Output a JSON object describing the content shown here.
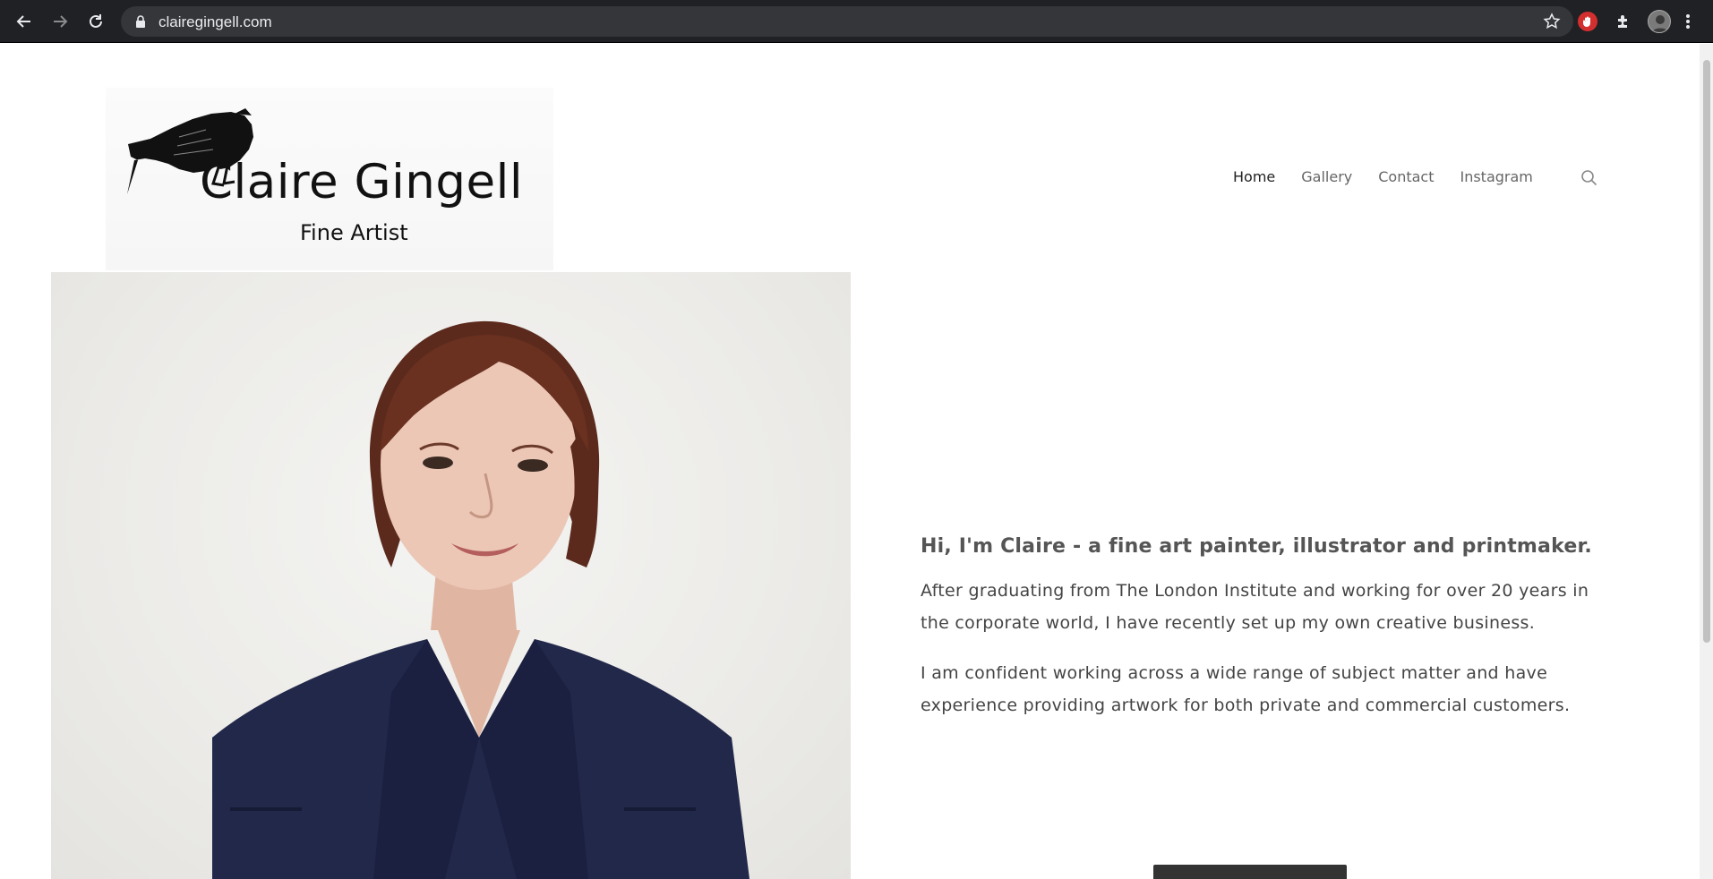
{
  "browser": {
    "url": "clairegingell.com"
  },
  "site": {
    "brand": "Claire Gingell",
    "tagline": "Fine Artist"
  },
  "nav": {
    "items": [
      {
        "label": "Home",
        "active": true
      },
      {
        "label": "Gallery",
        "active": false
      },
      {
        "label": "Contact",
        "active": false
      },
      {
        "label": "Instagram",
        "active": false
      }
    ]
  },
  "intro": {
    "heading": "Hi, I'm Claire - a fine art painter, illustrator and printmaker.",
    "paragraphs": [
      "After graduating from The London Institute and working for over 20 years in the corporate world, I have recently set up my own creative business.",
      "I am confident working across a wide range of subject matter and have experience providing artwork for both private and commercial customers."
    ]
  },
  "colors": {
    "chrome_bg": "#202124",
    "omnibox_bg": "#35363a",
    "heading_text": "#555555",
    "body_text": "#444444",
    "button_bg": "#333333"
  },
  "icons": [
    "back-icon",
    "forward-icon",
    "reload-icon",
    "lock-icon",
    "bookmark-star-icon",
    "adblock-icon",
    "extensions-icon",
    "profile-avatar",
    "menu-dots-icon",
    "crow-logo",
    "search-icon"
  ]
}
